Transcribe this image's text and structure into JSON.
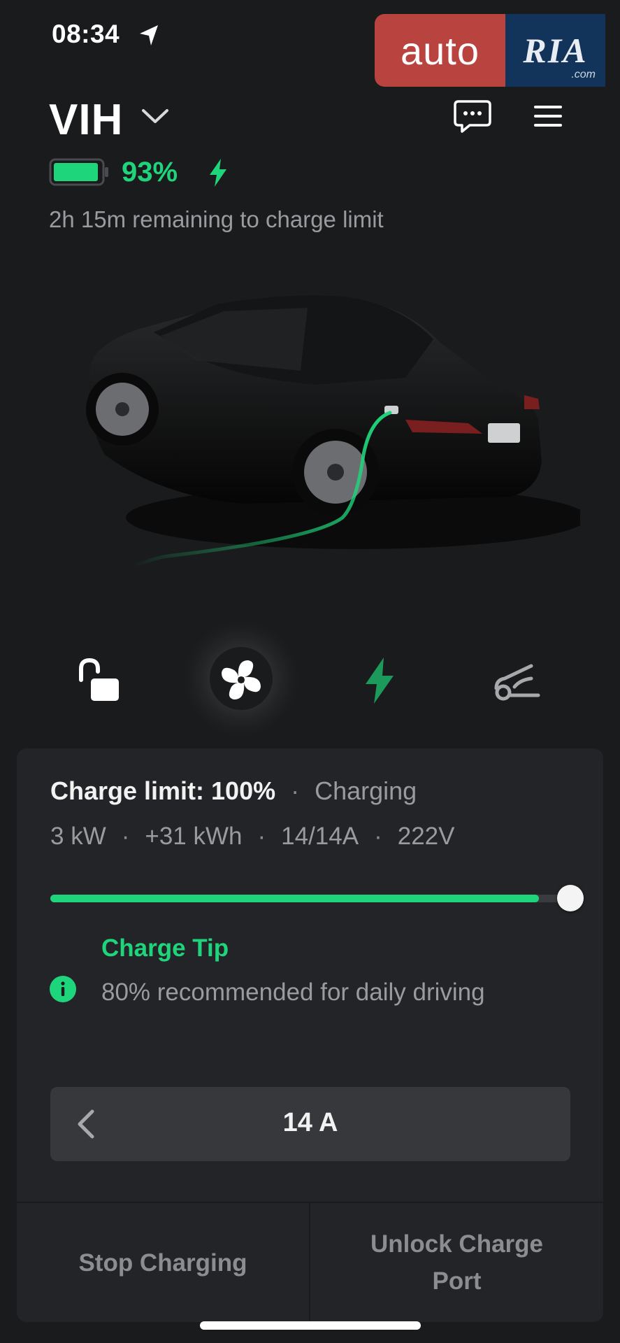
{
  "status_bar": {
    "time": "08:34",
    "location_icon": "location-arrow-icon"
  },
  "watermark": {
    "part1": "auto",
    "part2": "RIA",
    "part3": ".com"
  },
  "header": {
    "car_name": "VIH",
    "dropdown_icon": "chevron-down-icon",
    "chat_icon": "chat-icon",
    "menu_icon": "menu-icon"
  },
  "battery": {
    "level_fraction": 0.93,
    "percent_text": "93%",
    "remaining_text": "2h 15m remaining to charge limit",
    "color": "#1fd57b"
  },
  "controls": [
    {
      "name": "lock",
      "icon": "unlocked-padlock-icon"
    },
    {
      "name": "climate",
      "icon": "fan-icon"
    },
    {
      "name": "charging",
      "icon": "bolt-icon"
    },
    {
      "name": "frunk",
      "icon": "frunk-icon"
    }
  ],
  "charging": {
    "limit_label": "Charge limit: 100%",
    "status": "Charging",
    "separator": "·",
    "stats": [
      "3 kW",
      "+31 kWh",
      "14/14A",
      "222V"
    ],
    "slider_fraction": 0.94,
    "tip_title": "Charge Tip",
    "tip_text": "80% recommended for daily driving",
    "amps_value": "14 A",
    "stop_button": "Stop Charging",
    "unlock_button": "Unlock Charge Port"
  },
  "colors": {
    "accent": "#1fd57b",
    "background": "#1a1b1d",
    "card": "#232427"
  }
}
